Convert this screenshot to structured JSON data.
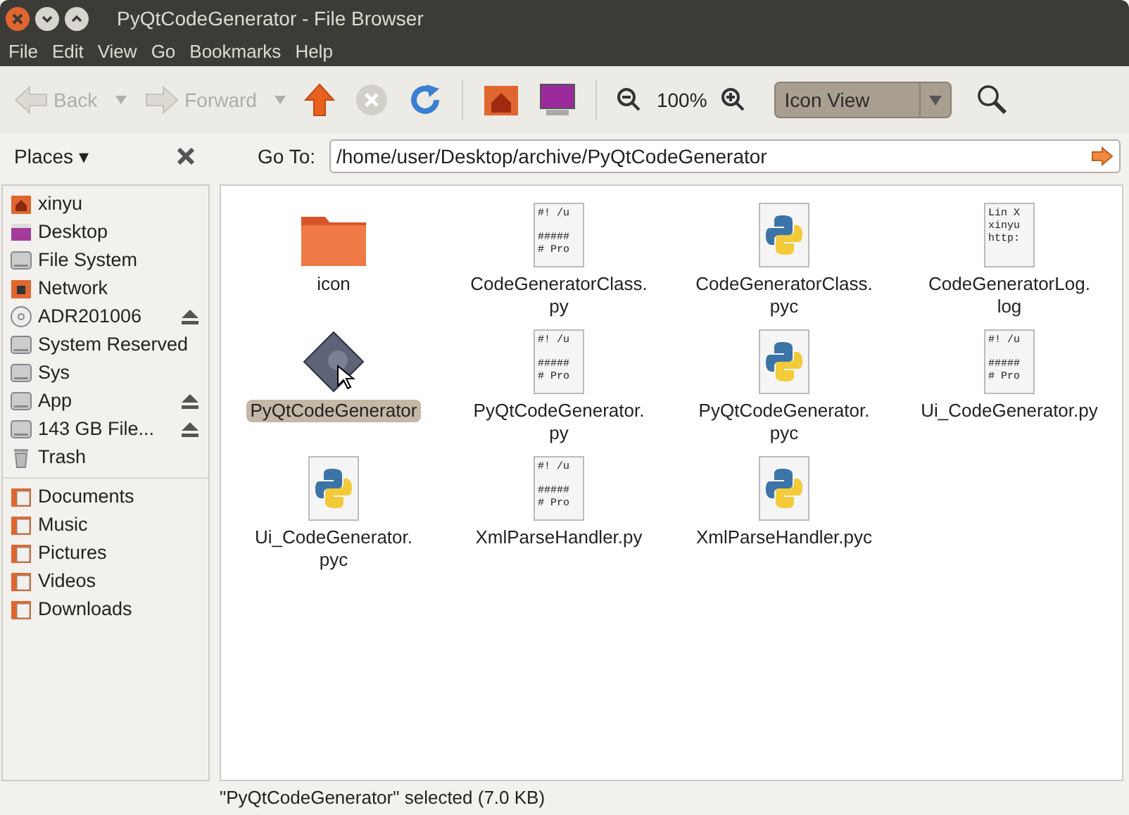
{
  "window": {
    "title": "PyQtCodeGenerator - File Browser"
  },
  "menu": [
    "File",
    "Edit",
    "View",
    "Go",
    "Bookmarks",
    "Help"
  ],
  "toolbar": {
    "back": {
      "label": "Back",
      "disabled": true
    },
    "forward": {
      "label": "Forward",
      "disabled": true
    },
    "stop_disabled": true,
    "zoom": "100%",
    "view": "Icon View"
  },
  "location": {
    "label": "Go To:",
    "value": "/home/user/Desktop/archive/PyQtCodeGenerator"
  },
  "sidebar": {
    "title": "Places ▾",
    "groups": [
      [
        {
          "label": "xinyu",
          "kind": "home",
          "eject": false
        },
        {
          "label": "Desktop",
          "kind": "desktop",
          "eject": false
        },
        {
          "label": "File System",
          "kind": "drive",
          "eject": false
        },
        {
          "label": "Network",
          "kind": "network",
          "eject": false
        },
        {
          "label": "ADR201006",
          "kind": "optical",
          "eject": true
        },
        {
          "label": "System Reserved",
          "kind": "drive",
          "eject": false
        },
        {
          "label": "Sys",
          "kind": "drive",
          "eject": false
        },
        {
          "label": "App",
          "kind": "drive",
          "eject": true
        },
        {
          "label": "143 GB File...",
          "kind": "drive",
          "eject": true
        },
        {
          "label": "Trash",
          "kind": "trash",
          "eject": false
        }
      ],
      [
        {
          "label": "Documents",
          "kind": "folder",
          "eject": false
        },
        {
          "label": "Music",
          "kind": "folder",
          "eject": false
        },
        {
          "label": "Pictures",
          "kind": "folder",
          "eject": false
        },
        {
          "label": "Videos",
          "kind": "folder",
          "eject": false
        },
        {
          "label": "Downloads",
          "kind": "folder",
          "eject": false
        }
      ]
    ]
  },
  "files": [
    {
      "name": [
        "icon"
      ],
      "kind": "folder",
      "selected": false
    },
    {
      "name": [
        "CodeGeneratorClass.",
        "py"
      ],
      "kind": "script",
      "preview": [
        "#! /u",
        "#####",
        "# Pro"
      ],
      "selected": false
    },
    {
      "name": [
        "CodeGeneratorClass.",
        "pyc"
      ],
      "kind": "python",
      "selected": false
    },
    {
      "name": [
        "CodeGeneratorLog.",
        "log"
      ],
      "kind": "text",
      "preview": [
        "Lin X",
        "xinyu",
        "http:"
      ],
      "selected": false
    },
    {
      "name": [
        "PyQtCodeGenerator"
      ],
      "kind": "executable",
      "selected": true
    },
    {
      "name": [
        "PyQtCodeGenerator.",
        "py"
      ],
      "kind": "script",
      "preview": [
        "#! /u",
        "#####",
        "# Pro"
      ],
      "selected": false
    },
    {
      "name": [
        "PyQtCodeGenerator.",
        "pyc"
      ],
      "kind": "python",
      "selected": false
    },
    {
      "name": [
        "Ui_CodeGenerator.py"
      ],
      "kind": "script",
      "preview": [
        "#! /u",
        "#####",
        "# Pro"
      ],
      "selected": false
    },
    {
      "name": [
        "Ui_CodeGenerator.",
        "pyc"
      ],
      "kind": "python",
      "selected": false
    },
    {
      "name": [
        "XmlParseHandler.py"
      ],
      "kind": "script",
      "preview": [
        "#! /u",
        "#####",
        "# Pro"
      ],
      "selected": false
    },
    {
      "name": [
        "XmlParseHandler.pyc"
      ],
      "kind": "python",
      "selected": false
    }
  ],
  "status_bar": "\"PyQtCodeGenerator\" selected (7.0 KB)"
}
